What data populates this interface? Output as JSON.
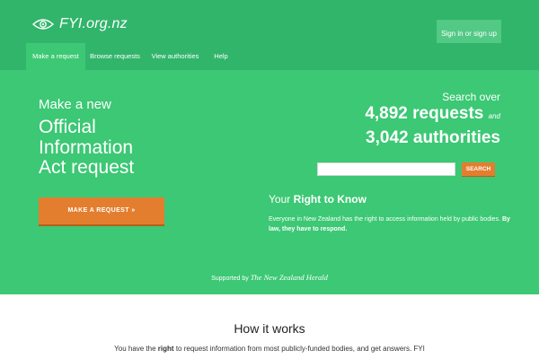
{
  "header": {
    "logo_text": "FYI.org.nz",
    "logo_icon": "eye-icon",
    "signin_label": "Sign in or sign up"
  },
  "nav": {
    "items": [
      {
        "label": "Make a request",
        "active": true
      },
      {
        "label": "Browse requests",
        "active": false
      },
      {
        "label": "View authorities",
        "active": false
      },
      {
        "label": "Help",
        "active": false
      }
    ]
  },
  "hero": {
    "make_new": "Make a new",
    "oia_lines": [
      "Official",
      "Information",
      "Act request"
    ],
    "make_button": "MAKE A REQUEST »",
    "search_over": "Search over",
    "requests_count": "4,892 requests",
    "and_word": "and",
    "authorities_count": "3,042 authorities",
    "search_button": "SEARCH",
    "rtk_prefix": "Your",
    "rtk_bold": "Right to Know",
    "rtk_text": "Everyone in New Zealand has the right to access information held by public bodies.",
    "rtk_bold_text": "By law, they have to respond.",
    "supported_by": "Supported by",
    "supporter": "The New Zealand Herald"
  },
  "how": {
    "title": "How it works",
    "text_prefix": "You have the",
    "text_bold": "right",
    "text_rest": "to request information from most publicly-funded bodies, and get answers. FYI"
  },
  "colors": {
    "brand_green": "#3cc874",
    "dark_green": "#31b56b",
    "accent_orange": "#e47e2f"
  }
}
